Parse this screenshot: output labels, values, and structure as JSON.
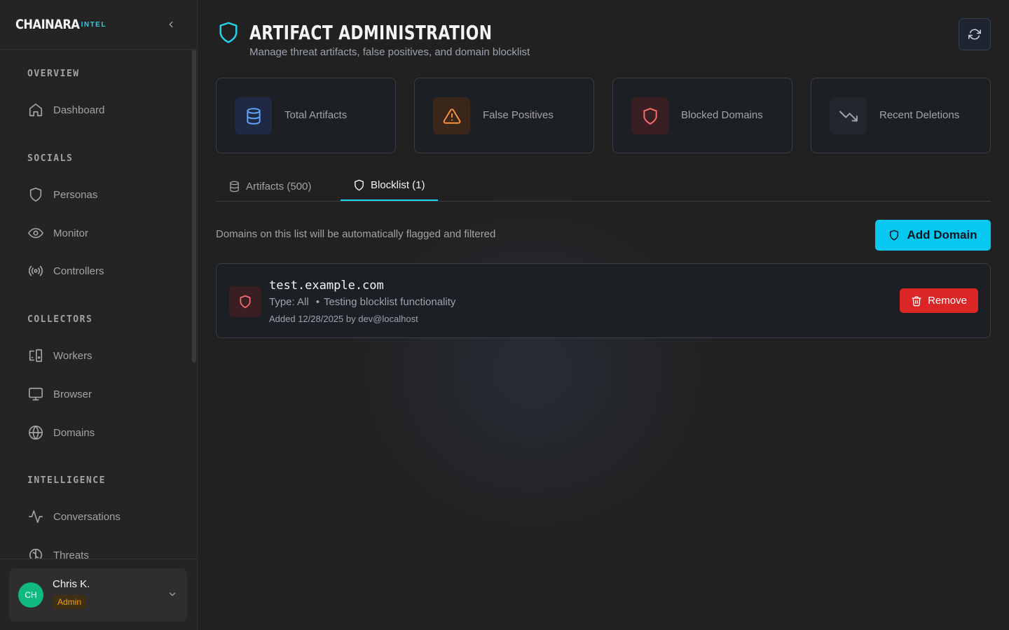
{
  "sidebar": {
    "brand": "CHAINARA",
    "brand_sub": "INTEL",
    "sections": [
      {
        "title": "OVERVIEW",
        "items": [
          {
            "label": "Dashboard",
            "icon": "home-icon"
          }
        ]
      },
      {
        "title": "SOCIALS",
        "items": [
          {
            "label": "Personas",
            "icon": "shield-icon"
          },
          {
            "label": "Monitor",
            "icon": "eye-icon"
          },
          {
            "label": "Controllers",
            "icon": "radio-icon"
          }
        ]
      },
      {
        "title": "COLLECTORS",
        "items": [
          {
            "label": "Workers",
            "icon": "devices-icon"
          },
          {
            "label": "Browser",
            "icon": "monitor-icon"
          },
          {
            "label": "Domains",
            "icon": "globe-icon"
          }
        ]
      },
      {
        "title": "INTELLIGENCE",
        "items": [
          {
            "label": "Conversations",
            "icon": "activity-icon"
          },
          {
            "label": "Threats",
            "icon": "brain-icon"
          }
        ]
      }
    ],
    "user": {
      "initials": "CH",
      "name": "Chris K.",
      "role": "Admin"
    }
  },
  "header": {
    "title": "ARTIFACT ADMINISTRATION",
    "subtitle": "Manage threat artifacts, false positives, and domain blocklist"
  },
  "stats": [
    {
      "label": "Total Artifacts",
      "icon": "database-icon",
      "color": "#60a5fa",
      "bg": "#1e2a44"
    },
    {
      "label": "False Positives",
      "icon": "warning-icon",
      "color": "#fb923c",
      "bg": "#3a261a"
    },
    {
      "label": "Blocked Domains",
      "icon": "shield-icon",
      "color": "#f87171",
      "bg": "#3a1f22"
    },
    {
      "label": "Recent Deletions",
      "icon": "trending-down-icon",
      "color": "#9ca3af",
      "bg": "#22262d"
    }
  ],
  "tabs": [
    {
      "label": "Artifacts (500)",
      "icon": "database-icon",
      "active": false
    },
    {
      "label": "Blocklist (1)",
      "icon": "shield-icon",
      "active": true
    }
  ],
  "blocklist": {
    "description": "Domains on this list will be automatically flagged and filtered",
    "add_label": "Add Domain",
    "entries": [
      {
        "domain": "test.example.com",
        "type": "Type: All",
        "reason": "Testing blocklist functionality",
        "added": "Added 12/28/2025 by dev@localhost",
        "remove_label": "Remove"
      }
    ]
  },
  "colors": {
    "accent": "#22d3ee",
    "danger": "#dc2626",
    "warning": "#f59e0b",
    "avatar": "#10b981"
  }
}
